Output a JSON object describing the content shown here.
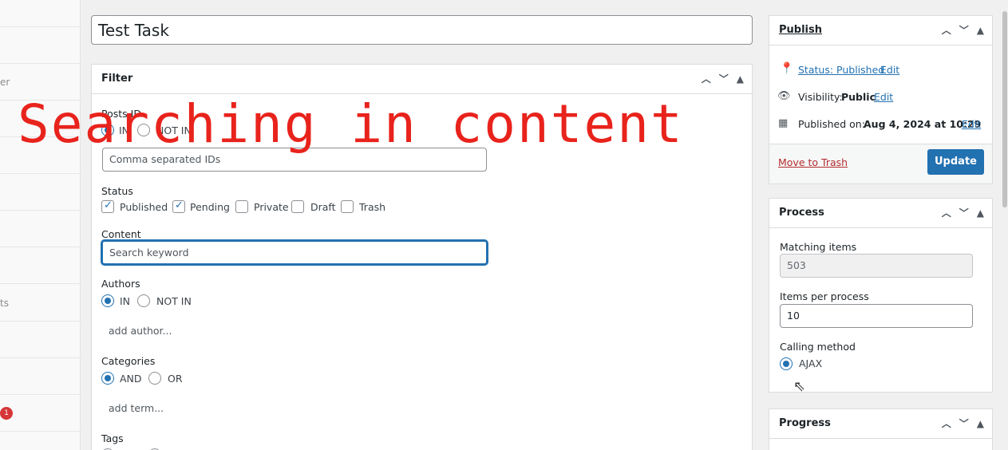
{
  "sidebar": {
    "frag1": "er",
    "frag2": "ts",
    "badge": "1"
  },
  "title": {
    "value": "Test Task"
  },
  "filter": {
    "heading": "Filter",
    "posts_id": {
      "label": "Posts ID",
      "in": "IN",
      "not_in": "NOT IN",
      "placeholder": "Comma separated IDs"
    },
    "status": {
      "label": "Status",
      "options": [
        "Published",
        "Pending",
        "Private",
        "Draft",
        "Trash"
      ]
    },
    "content": {
      "label": "Content",
      "placeholder": "Search keyword"
    },
    "authors": {
      "label": "Authors",
      "in": "IN",
      "not_in": "NOT IN",
      "add": "add author..."
    },
    "categories": {
      "label": "Categories",
      "and": "AND",
      "or": "OR",
      "add": "add term..."
    },
    "tags": {
      "label": "Tags"
    }
  },
  "publish": {
    "heading": "Publish",
    "status_label": "Status: Published",
    "status_edit": "Edit",
    "visibility_label": "Visibility:",
    "visibility_value": "Public",
    "visibility_edit": "Edit",
    "published_label": "Published on:",
    "published_value": "Aug 4, 2024 at 10:29",
    "published_edit": "Edit",
    "trash": "Move to Trash",
    "update": "Update"
  },
  "process": {
    "heading": "Process",
    "matching_label": "Matching items",
    "matching_value": "503",
    "per_process_label": "Items per process",
    "per_process_value": "10",
    "calling_label": "Calling method",
    "calling_option": "AJAX"
  },
  "progress": {
    "heading": "Progress"
  },
  "overlay_text": "Searching in content",
  "colors": {
    "accent": "#2271b1",
    "overlay": "#e8231c",
    "danger": "#b32d2e"
  }
}
